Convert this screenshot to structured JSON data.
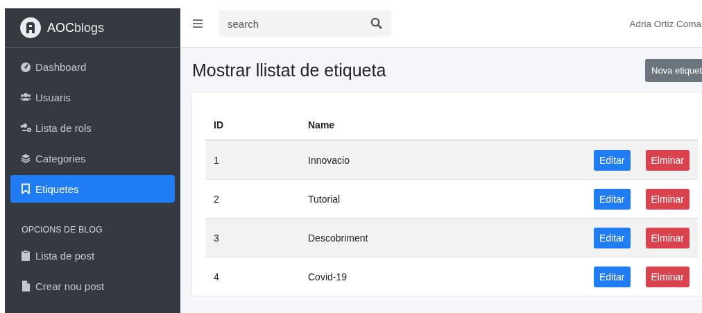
{
  "brand": {
    "name_bold": "AOC",
    "name_light": "blogs"
  },
  "sidebar": {
    "items": [
      {
        "label": "Dashboard",
        "selected": false
      },
      {
        "label": "Usuaris",
        "selected": false
      },
      {
        "label": "Lista de rols",
        "selected": false
      },
      {
        "label": "Categories",
        "selected": false
      },
      {
        "label": "Etiquetes",
        "selected": true
      }
    ],
    "section_header": "OPCIONS DE BLOG",
    "section_items": [
      {
        "label": "Lista de post",
        "selected": false
      },
      {
        "label": "Crear nou post",
        "selected": false
      }
    ]
  },
  "topbar": {
    "search": {
      "placeholder": "search"
    },
    "user": "Adria Ortiz Coma"
  },
  "page": {
    "title": "Mostrar llistat de etiqueta",
    "new_button": "Nova etiquet"
  },
  "table": {
    "columns": [
      "ID",
      "Name"
    ],
    "rows": [
      {
        "id": "1",
        "name": "Innovacio",
        "edit": "Editar",
        "delete": "Elminar"
      },
      {
        "id": "2",
        "name": "Tutorial",
        "edit": "Editar",
        "delete": "Elminar"
      },
      {
        "id": "3",
        "name": "Descobriment",
        "edit": "Editar",
        "delete": "Elminar"
      },
      {
        "id": "4",
        "name": "Covid-19",
        "edit": "Editar",
        "delete": "Elminar"
      }
    ]
  }
}
